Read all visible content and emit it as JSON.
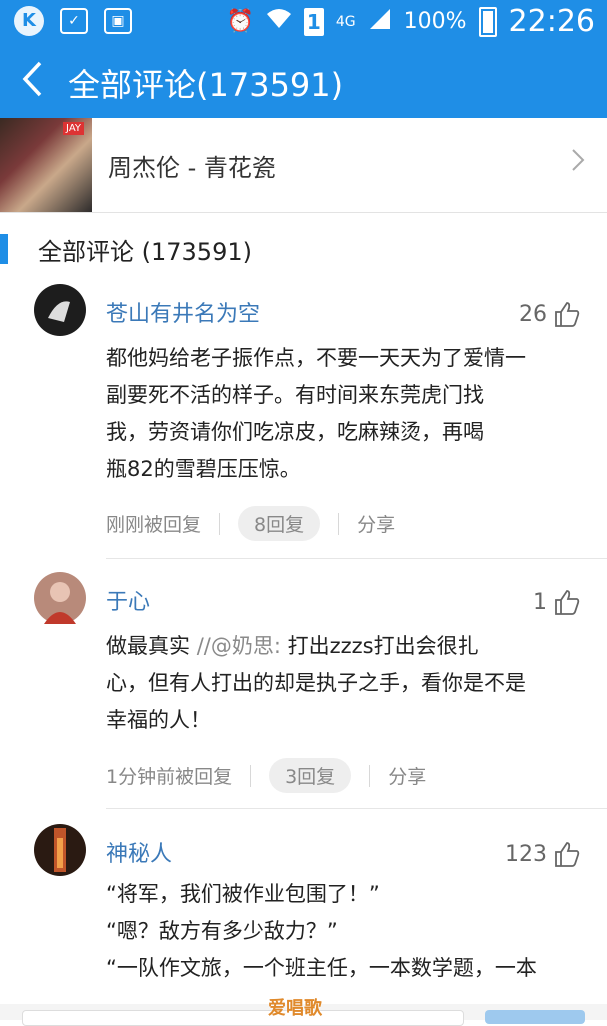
{
  "status_bar": {
    "signal_4g": "4G",
    "sim": "1",
    "battery": "100%",
    "time": "22:26"
  },
  "header": {
    "title": "全部评论(173591)"
  },
  "song": {
    "title": "周杰伦 - 青花瓷",
    "cover_tag": "JAY"
  },
  "section": {
    "title": "全部评论 (173591)"
  },
  "comments": [
    {
      "user": "苍山有井名为空",
      "likes": "26",
      "lines": [
        "都他妈给老子振作点，不要一天天为了爱情一",
        "副要死不活的样子。有时间来东莞虎门找",
        "我，劳资请你们吃凉皮，吃麻辣烫，再喝",
        "瓶82的雪碧压压惊。"
      ],
      "time": "刚刚被回复",
      "replies": "8回复",
      "share": "分享",
      "avatar_color": "#1d1d1d"
    },
    {
      "user": "于心",
      "likes": "1",
      "quote_prefix": "做最真实 ",
      "quote_ref": "//@奶思:",
      "lines_after_quote": " 打出zzzs打出会很扎",
      "lines": [
        "心，但有人打出的却是执子之手，看你是不是",
        "幸福的人！"
      ],
      "time": "1分钟前被回复",
      "replies": "3回复",
      "share": "分享",
      "avatar_color": "#b88a7a"
    },
    {
      "user": "神秘人",
      "likes": "123",
      "lines": [
        "“将军，我们被作业包围了！”",
        "“嗯？敌方有多少敌力？”",
        "“一队作文旅，一个班主任，一本数学题，一本"
      ],
      "avatar_color": "#2a1a12"
    }
  ],
  "watermark": "爱唱歌"
}
